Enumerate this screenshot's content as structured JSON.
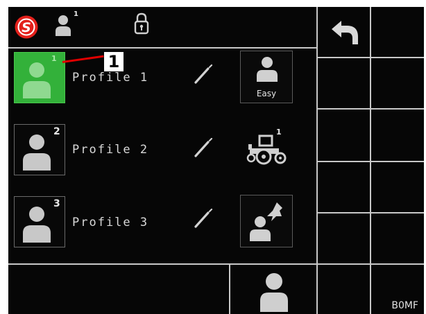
{
  "header": {
    "brand_letter": "S",
    "user_badge": "1",
    "lock_icon": "lock-icon",
    "back_icon": "undo-arrow-icon"
  },
  "profiles": [
    {
      "label": "Profile 1",
      "number": "1",
      "active": true
    },
    {
      "label": "Profile 2",
      "number": "2",
      "active": false
    },
    {
      "label": "Profile 3",
      "number": "3",
      "active": false
    }
  ],
  "side_buttons": {
    "easy_label": "Easy",
    "tractor_badge": "1"
  },
  "callout": {
    "number": "1"
  },
  "image_tag": "B0MF",
  "colors": {
    "brand_red": "#e3201b",
    "active_green": "#33b13a",
    "background": "#060606",
    "icon_grey": "#c9c9c9"
  }
}
